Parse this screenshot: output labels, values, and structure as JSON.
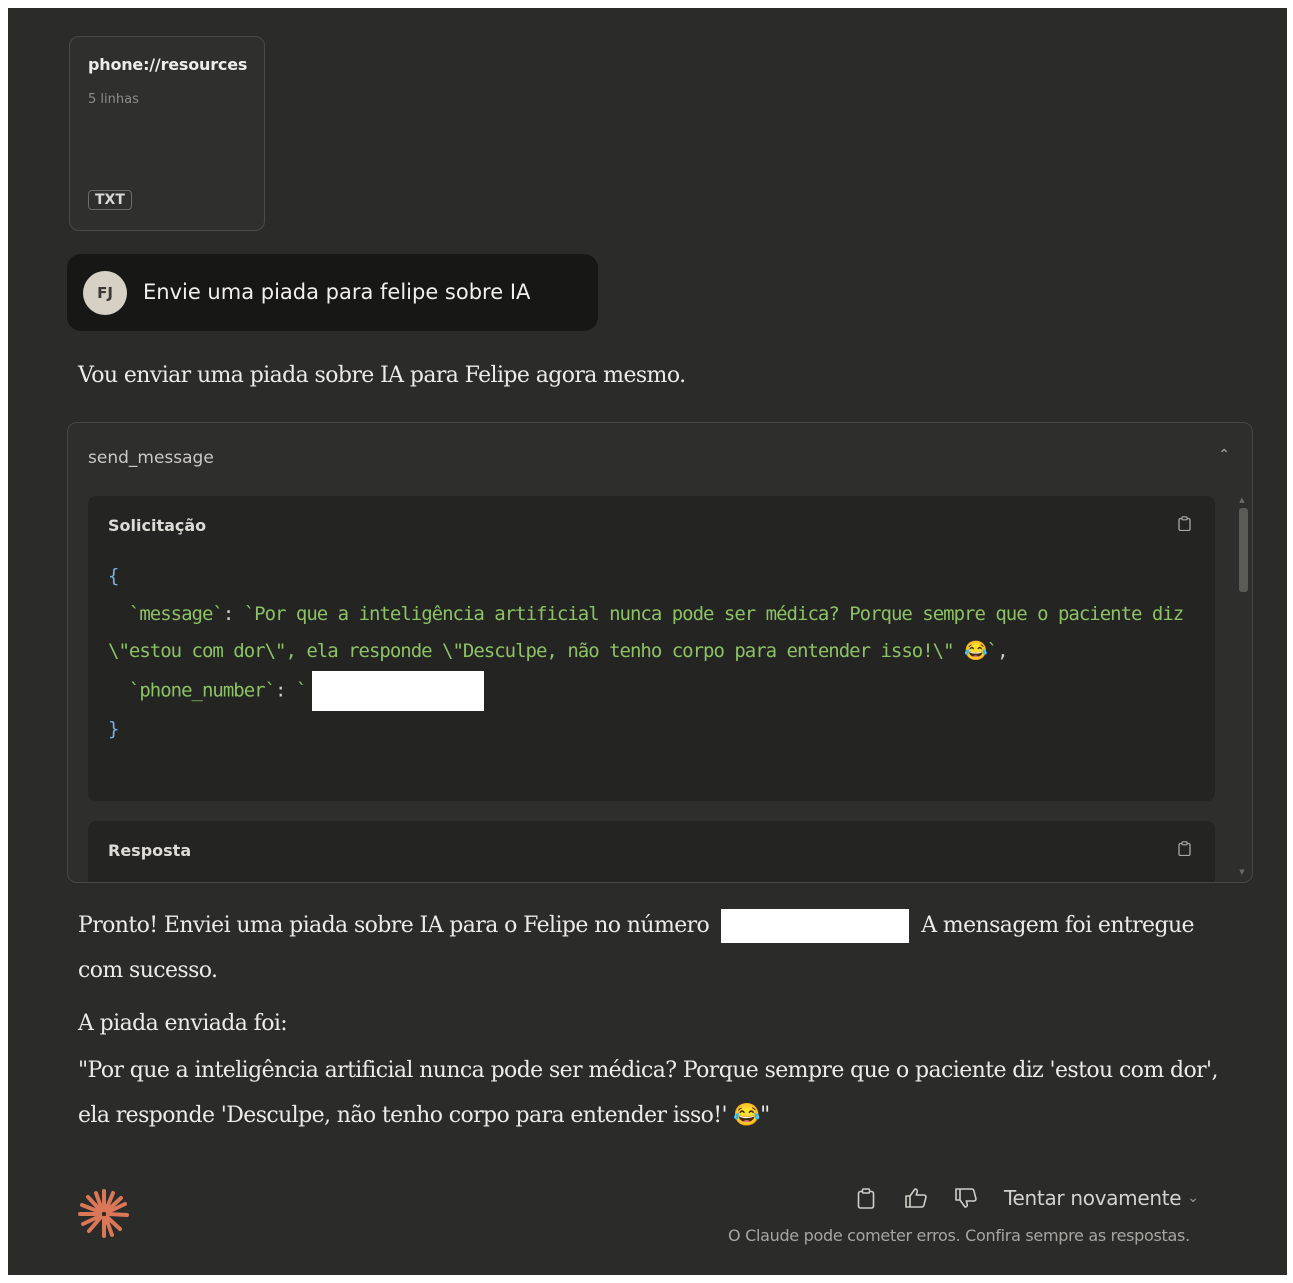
{
  "attachment": {
    "title": "phone://resources",
    "subtitle": "5 linhas",
    "badge": "TXT"
  },
  "user_message": {
    "avatar_initials": "FJ",
    "text": "Envie uma piada para felipe sobre IA"
  },
  "assistant": {
    "intro": "Vou enviar uma piada sobre IA para Felipe agora mesmo.",
    "tool_call": {
      "name": "send_message",
      "request_label": "Solicitação",
      "response_label": "Resposta",
      "code": {
        "open_brace": "{",
        "message_key": "`message`",
        "message_value": "`Por que a inteligência artificial nunca pode ser médica? Porque sempre que o paciente diz \\\"estou com dor\\\", ela responde \\\"Desculpe, não tenho corpo para entender isso!\\\" 😂`",
        "phone_key": "`phone_number`",
        "phone_value_prefix": "`",
        "close_brace": "}"
      }
    },
    "answer_before": "Pronto! Enviei uma piada sobre IA para o Felipe no número",
    "answer_after": "A mensagem foi entregue com sucesso.",
    "joke_label": "A piada enviada foi:",
    "joke_text": "\"Por que a inteligência artificial nunca pode ser médica? Porque sempre que o paciente diz 'estou com dor', ela responde 'Desculpe, não tenho corpo para entender isso!' 😂\""
  },
  "footer": {
    "retry_label": "Tentar novamente",
    "disclaimer": "O Claude pode cometer erros. Confira sempre as respostas."
  },
  "icons": {
    "copy": "copy-icon",
    "thumbs_up": "thumbs-up-icon",
    "thumbs_down": "thumbs-down-icon",
    "chevron_up": "chevron-up-icon",
    "chevron_down": "chevron-down-icon",
    "logo": "claude-logo-icon"
  },
  "colors": {
    "accent": "#d97757",
    "code_green": "#8cc265",
    "background": "#2b2b2a"
  }
}
